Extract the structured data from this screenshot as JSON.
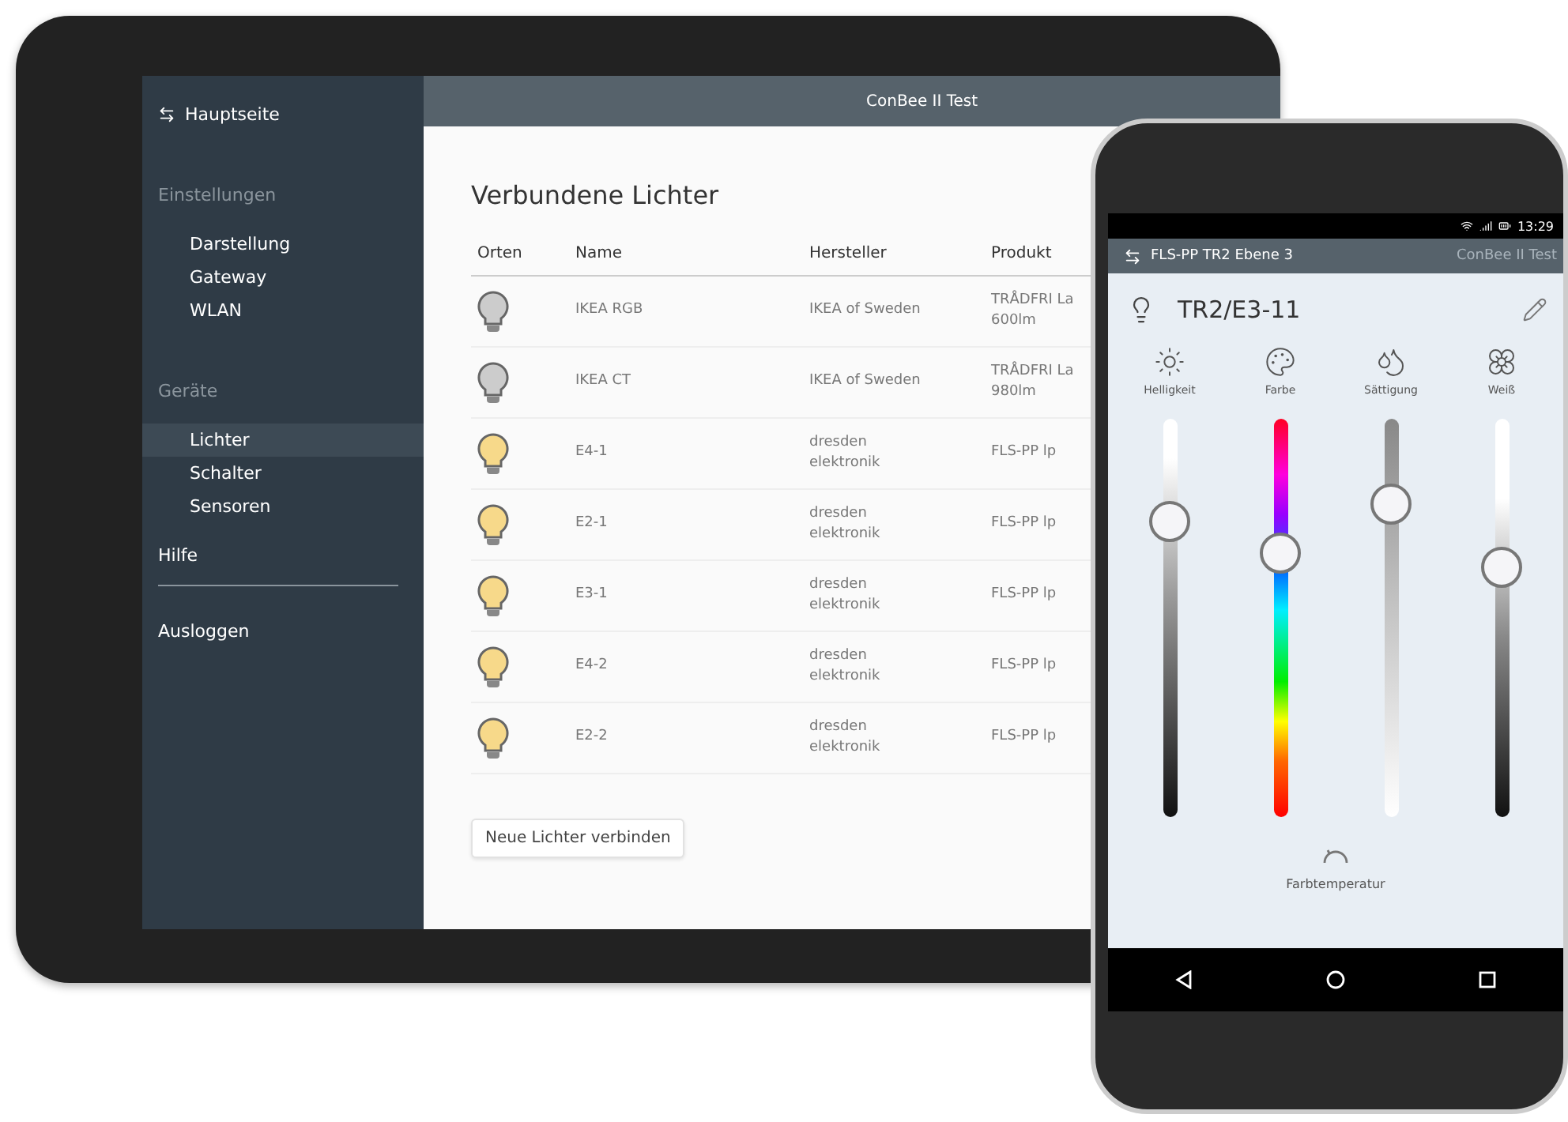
{
  "tablet": {
    "sidebar": {
      "items": [
        {
          "kind": "home",
          "label": "Hauptseite",
          "selected": false
        },
        {
          "kind": "section",
          "label": "Einstellungen",
          "selected": false
        },
        {
          "kind": "item",
          "label": "Darstellung",
          "selected": false
        },
        {
          "kind": "item",
          "label": "Gateway",
          "selected": false
        },
        {
          "kind": "item",
          "label": "WLAN",
          "selected": false
        },
        {
          "kind": "section",
          "label": "Geräte",
          "selected": false
        },
        {
          "kind": "item",
          "label": "Lichter",
          "selected": true
        },
        {
          "kind": "item",
          "label": "Schalter",
          "selected": false
        },
        {
          "kind": "item",
          "label": "Sensoren",
          "selected": false
        },
        {
          "kind": "top",
          "label": "Hilfe",
          "selected": false
        },
        {
          "kind": "divider"
        },
        {
          "kind": "top",
          "label": "Ausloggen",
          "selected": false
        }
      ]
    },
    "top_bar": {
      "gateway": "ConBee II Test"
    },
    "title": "Verbundene Lichter",
    "table": {
      "columns": [
        "Orten",
        "Name",
        "Hersteller",
        "Produkt"
      ],
      "rows": [
        {
          "on": false,
          "name": "IKEA RGB",
          "manufacturer": "IKEA of Sweden",
          "product": "TRÅDFRI La\n600lm"
        },
        {
          "on": false,
          "name": "IKEA CT",
          "manufacturer": "IKEA of Sweden",
          "product": "TRÅDFRI La\n980lm"
        },
        {
          "on": true,
          "name": "E4-1",
          "manufacturer": "dresden\nelektronik",
          "product": "FLS-PP lp"
        },
        {
          "on": true,
          "name": "E2-1",
          "manufacturer": "dresden\nelektronik",
          "product": "FLS-PP lp"
        },
        {
          "on": true,
          "name": "E3-1",
          "manufacturer": "dresden\nelektronik",
          "product": "FLS-PP lp"
        },
        {
          "on": true,
          "name": "E4-2",
          "manufacturer": "dresden\nelektronik",
          "product": "FLS-PP lp"
        },
        {
          "on": true,
          "name": "E2-2",
          "manufacturer": "dresden\nelektronik",
          "product": "FLS-PP lp"
        }
      ]
    },
    "button": "Neue Lichter verbinden"
  },
  "phone": {
    "status_bar": {
      "time": "13:29"
    },
    "app_bar": {
      "title": "FLS-PP TR2 Ebene 3",
      "gateway": "ConBee II Test"
    },
    "light_name": "TR2/E3-11",
    "sliders": [
      {
        "kind": "brightness",
        "label": "Helligkeit",
        "level": 0.77
      },
      {
        "kind": "color",
        "label": "Farbe",
        "level": 0.68
      },
      {
        "kind": "saturation",
        "label": "Sättigung",
        "level": 0.82
      },
      {
        "kind": "white",
        "label": "Weiß",
        "level": 0.64
      }
    ],
    "color_temperature": {
      "label": "Farbtemperatur"
    }
  }
}
